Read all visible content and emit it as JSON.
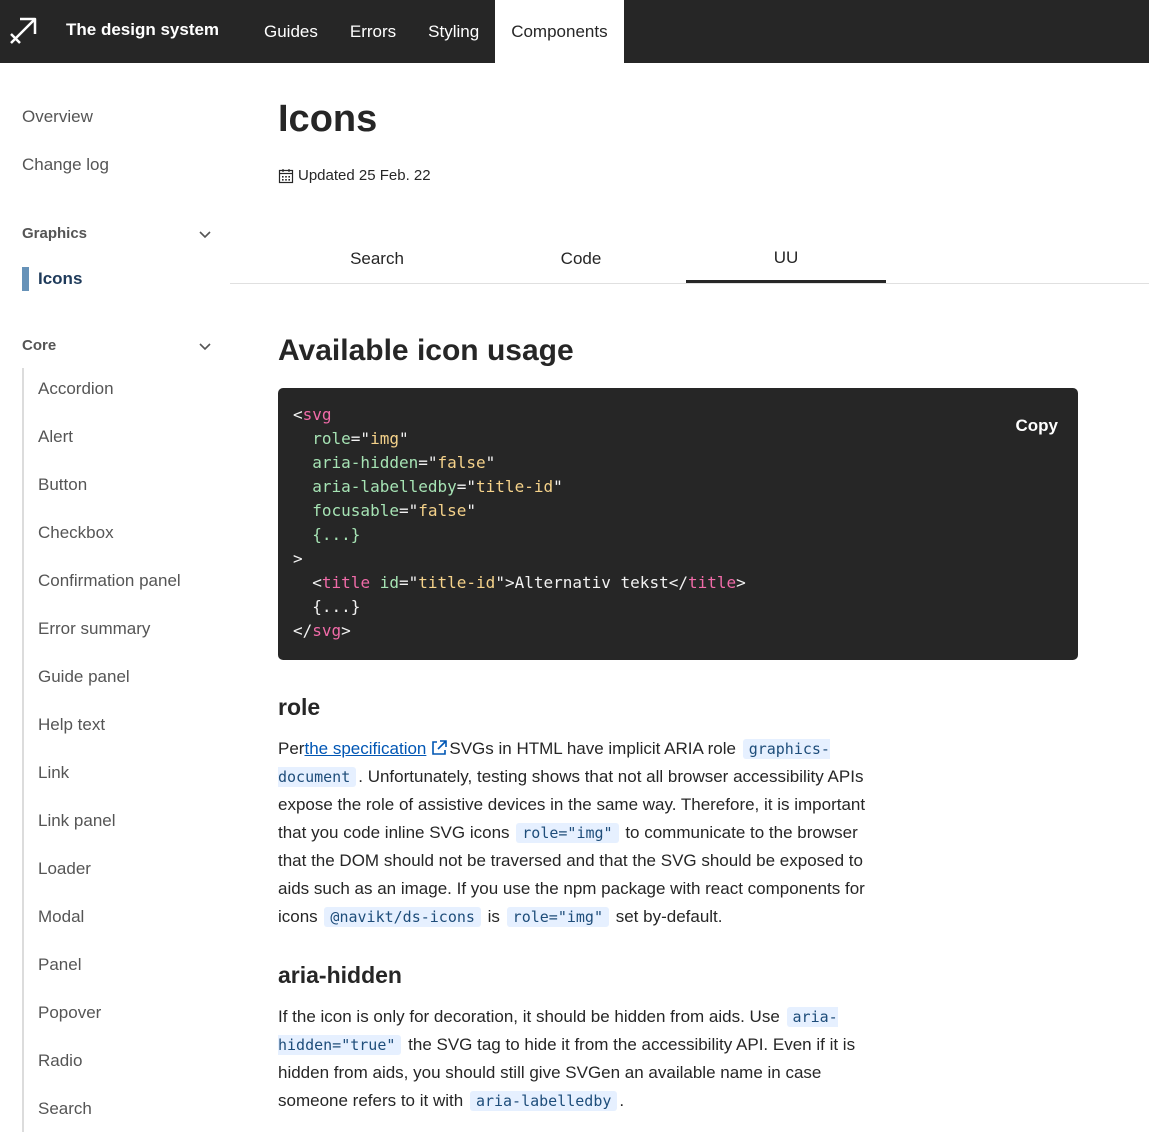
{
  "header": {
    "brand": "The design system",
    "nav": [
      "Guides",
      "Errors",
      "Styling",
      "Components"
    ],
    "active_nav": "Components"
  },
  "sidebar": {
    "overview": "Overview",
    "changelog": "Change log",
    "graphics_group": "Graphics",
    "active_item": "Icons",
    "core_group": "Core",
    "core_items": [
      "Accordion",
      "Alert",
      "Button",
      "Checkbox",
      "Confirmation panel",
      "Error summary",
      "Guide panel",
      "Help text",
      "Link",
      "Link panel",
      "Loader",
      "Modal",
      "Panel",
      "Popover",
      "Radio",
      "Search"
    ]
  },
  "main": {
    "title": "Icons",
    "updated": "Updated 25 Feb. 22",
    "tabs": [
      "Search",
      "Code",
      "UU"
    ],
    "active_tab": "UU",
    "section_title": "Available icon usage",
    "code": {
      "lines": [
        [
          [
            "p",
            "<"
          ],
          [
            "g",
            "svg"
          ]
        ],
        [
          [
            "p",
            "  "
          ],
          [
            "a",
            "role"
          ],
          [
            "p",
            "=\""
          ],
          [
            "s",
            "img"
          ],
          [
            "p",
            "\""
          ]
        ],
        [
          [
            "p",
            "  "
          ],
          [
            "a",
            "aria-hidden"
          ],
          [
            "p",
            "=\""
          ],
          [
            "s",
            "false"
          ],
          [
            "p",
            "\""
          ]
        ],
        [
          [
            "p",
            "  "
          ],
          [
            "a",
            "aria-labelledby"
          ],
          [
            "p",
            "=\""
          ],
          [
            "s",
            "title-id"
          ],
          [
            "p",
            "\""
          ]
        ],
        [
          [
            "p",
            "  "
          ],
          [
            "a",
            "focusable"
          ],
          [
            "p",
            "=\""
          ],
          [
            "s",
            "false"
          ],
          [
            "p",
            "\""
          ]
        ],
        [
          [
            "p",
            "  "
          ],
          [
            "a",
            "{...}"
          ]
        ],
        [
          [
            "p",
            ">"
          ]
        ],
        [
          [
            "p",
            "  <"
          ],
          [
            "g",
            "title"
          ],
          [
            "p",
            " "
          ],
          [
            "a",
            "id"
          ],
          [
            "p",
            "=\""
          ],
          [
            "s",
            "title-id"
          ],
          [
            "p",
            "\">Alternativ tekst</"
          ],
          [
            "g",
            "title"
          ],
          [
            "p",
            ">"
          ]
        ],
        [
          [
            "p",
            "  {...}"
          ]
        ],
        [
          [
            "p",
            "</"
          ],
          [
            "g",
            "svg"
          ],
          [
            "p",
            ">"
          ]
        ]
      ],
      "copy_label": "Copy"
    },
    "role": {
      "heading": "role",
      "p1_a": "Per",
      "link": "the specification",
      "p1_b": "SVGs in HTML have implicit ARIA role",
      "code1": "graphics-document",
      "p2": ". Unfortunately, testing shows that not all browser accessibility APIs expose the role of assistive devices in the same way. Therefore, it is important that you code inline SVG icons",
      "code2": "role=\"img\"",
      "p3": "to communicate to the browser that the DOM should not be traversed and that the SVG should be exposed to aids such as an image. If you use the npm package with react components for icons",
      "code3": "@navikt/ds-icons",
      "p4": "is",
      "code4": "role=\"img\"",
      "p5": "set by-default."
    },
    "aria_hidden": {
      "heading": "aria-hidden",
      "p1": "If the icon is only for decoration, it should be hidden from aids. Use",
      "code1": "aria-hidden=\"true\"",
      "p2": "the SVG tag to hide it from the accessibility API. Even if it is hidden from aids, you should still give SVGen an available name in case someone refers to it with",
      "code2": "aria-labelledby",
      "p3": "."
    }
  }
}
